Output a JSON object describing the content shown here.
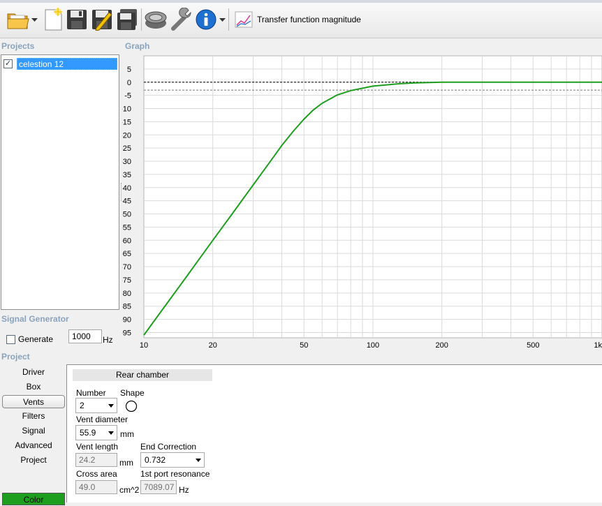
{
  "toolbar": {
    "items": [
      {
        "name": "open-folder-icon"
      },
      {
        "name": "new-document-icon"
      },
      {
        "name": "save-icon"
      },
      {
        "name": "save-as-icon"
      },
      {
        "name": "save-all-icon"
      },
      {
        "name": "driver-icon"
      },
      {
        "name": "tools-icon"
      },
      {
        "name": "info-icon"
      }
    ],
    "graph_mode_label": "Transfer function magnitude"
  },
  "projects": {
    "title": "Projects",
    "items": [
      {
        "label": "celestion 12",
        "checked": true
      }
    ]
  },
  "graph": {
    "title": "Graph"
  },
  "signal_generator": {
    "title": "Signal Generator",
    "generate_label": "Generate",
    "frequency_value": "1000",
    "frequency_unit": "Hz"
  },
  "project": {
    "title": "Project",
    "nav": [
      "Driver",
      "Box",
      "Vents",
      "Filters",
      "Signal",
      "Advanced",
      "Project"
    ],
    "selected_nav": "Vents",
    "color_label": "Color",
    "color_value": "#1e9e1e"
  },
  "vents": {
    "tab_label": "Rear chamber",
    "number_label": "Number",
    "number_value": "2",
    "shape_label": "Shape",
    "shape_icon": "circle-icon",
    "vent_diameter_label": "Vent diameter",
    "vent_diameter_value": "55.9",
    "vent_diameter_unit": "mm",
    "vent_length_label": "Vent length",
    "vent_length_value": "24.2",
    "vent_length_unit": "mm",
    "end_correction_label": "End Correction",
    "end_correction_value": "0.732",
    "cross_area_label": "Cross area",
    "cross_area_value": "49.0",
    "cross_area_unit": "cm^2",
    "port_resonance_label": "1st port resonance",
    "port_resonance_value": "7089.07",
    "port_resonance_unit": "Hz"
  },
  "chart_data": {
    "type": "line",
    "title": "",
    "xlabel": "",
    "ylabel": "",
    "x_scale": "log",
    "xlim": [
      10,
      1000
    ],
    "ylim": [
      -97,
      10
    ],
    "x_ticks": [
      10,
      20,
      50,
      100,
      200,
      500,
      1000
    ],
    "x_tick_labels": [
      "10",
      "20",
      "50",
      "100",
      "200",
      "500",
      "1k"
    ],
    "y_ticks": [
      5,
      0,
      -5,
      -10,
      -15,
      -20,
      -25,
      -30,
      -35,
      -40,
      -45,
      -50,
      -55,
      -60,
      -65,
      -70,
      -75,
      -80,
      -85,
      -90,
      -95
    ],
    "y_tick_labels": [
      "5",
      "0",
      "-5",
      "-10",
      "-15",
      "-20",
      "-25",
      "-30",
      "-35",
      "-40",
      "-45",
      "-50",
      "-55",
      "-60",
      "-65",
      "-70",
      "-75",
      "-80",
      "-85",
      "-90",
      "-95"
    ],
    "grid": true,
    "reference_lines": [
      0,
      -3
    ],
    "series": [
      {
        "color": "#1e9e1e",
        "x": [
          10,
          12,
          15,
          20,
          25,
          30,
          35,
          40,
          45,
          50,
          55,
          60,
          70,
          80,
          100,
          130,
          150,
          200,
          300,
          500,
          1000
        ],
        "y": [
          -96,
          -86.5,
          -75,
          -60,
          -48.5,
          -39,
          -31,
          -24,
          -18.5,
          -14,
          -10.5,
          -8,
          -4.8,
          -3.2,
          -1.5,
          -0.6,
          -0.3,
          0,
          0,
          0,
          0
        ]
      }
    ]
  }
}
